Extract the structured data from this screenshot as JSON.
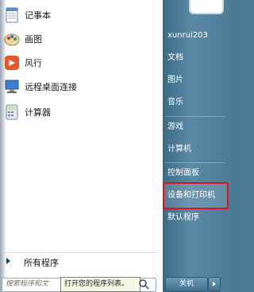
{
  "programs": [
    {
      "label": "记事本",
      "icon": "notepad-icon"
    },
    {
      "label": "画图",
      "icon": "paint-icon"
    },
    {
      "label": "风行",
      "icon": "funshion-icon"
    },
    {
      "label": "远程桌面连接",
      "icon": "remote-desktop-icon"
    },
    {
      "label": "计算器",
      "icon": "calculator-icon"
    }
  ],
  "all_programs_label": "所有程序",
  "search": {
    "placeholder": "搜索程序和文",
    "tooltip": "打开您的程序列表。"
  },
  "right": {
    "username": "xunrui203",
    "items": [
      "文档",
      "图片",
      "音乐",
      "游戏",
      "计算机",
      "控制面板",
      "设备和打印机",
      "默认程序"
    ]
  },
  "shutdown_label": "关机",
  "colors": {
    "highlight": "#e0101c"
  }
}
